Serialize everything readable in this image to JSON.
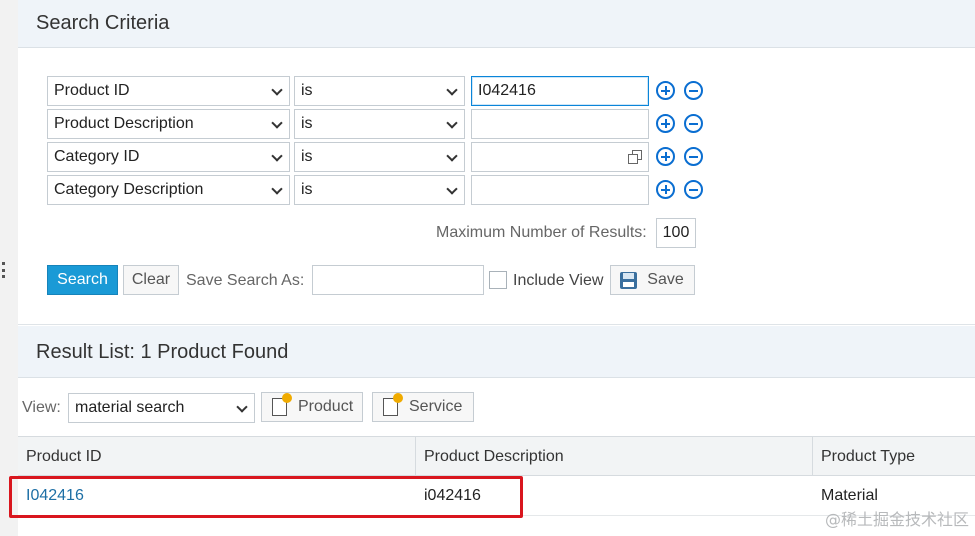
{
  "search_criteria": {
    "title": "Search Criteria",
    "rows": [
      {
        "field": "Product ID",
        "operator": "is",
        "value": ""
      },
      {
        "field": "Product Description",
        "operator": "is",
        "value": ""
      },
      {
        "field": "Category ID",
        "operator": "is",
        "value": ""
      },
      {
        "field": "Category Description",
        "operator": "is",
        "value": ""
      }
    ],
    "first_value": "I042416",
    "max_results_label": "Maximum Number of Results:",
    "max_results_value": "100",
    "search_button": "Search",
    "clear_button": "Clear",
    "save_search_label": "Save Search As:",
    "save_search_value": "",
    "include_view_label": "Include View",
    "include_view_checked": false,
    "save_button": "Save"
  },
  "result_list": {
    "title": "Result List: 1 Product Found",
    "view_label": "View:",
    "view_value": "material search",
    "new_product_button": "Product",
    "new_service_button": "Service",
    "columns": [
      "Product ID",
      "Product Description",
      "Product Type"
    ],
    "rows": [
      {
        "product_id": "I042416",
        "description": "i042416",
        "type": "Material"
      }
    ]
  },
  "watermark": "@稀土掘金技术社区",
  "colors": {
    "primary_button": "#1a9ad6",
    "link": "#1d6fa5",
    "highlight_box": "#d9161e",
    "icon_blue": "#0a6ed1"
  }
}
